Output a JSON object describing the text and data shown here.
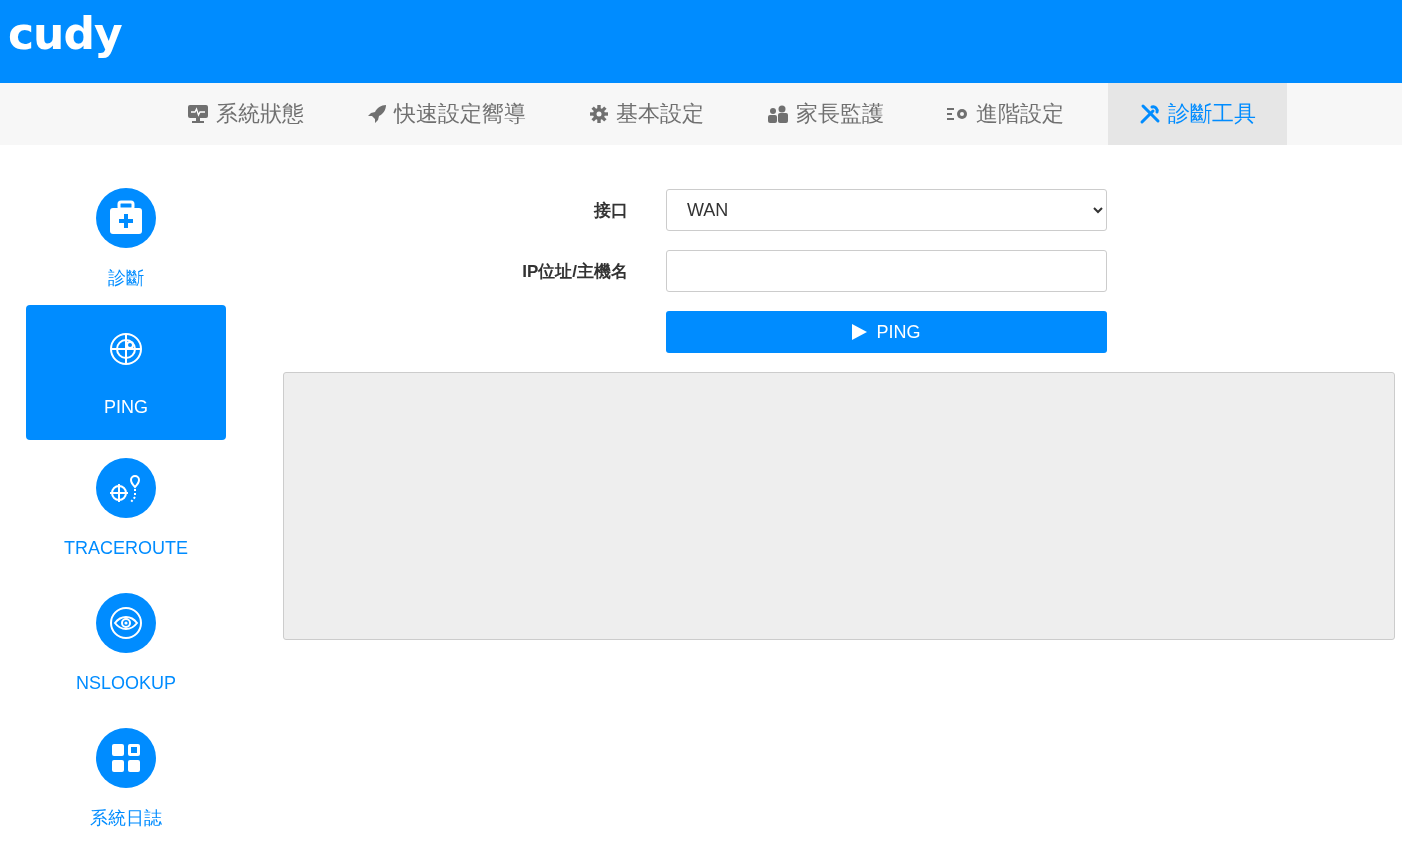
{
  "header": {
    "logo": "cudy"
  },
  "nav": [
    {
      "label": "系統狀態",
      "selected": false
    },
    {
      "label": "快速設定嚮導",
      "selected": false
    },
    {
      "label": "基本設定",
      "selected": false
    },
    {
      "label": "家長監護",
      "selected": false
    },
    {
      "label": "進階設定",
      "selected": false
    },
    {
      "label": "診斷工具",
      "selected": true
    }
  ],
  "sidebar": [
    {
      "label": "診斷",
      "selected": false
    },
    {
      "label": "PING",
      "selected": true
    },
    {
      "label": "TRACEROUTE",
      "selected": false
    },
    {
      "label": "NSLOOKUP",
      "selected": false
    },
    {
      "label": "系統日誌",
      "selected": false
    }
  ],
  "form": {
    "interface": {
      "label": "接口",
      "value": "WAN"
    },
    "host": {
      "label": "IP位址/主機名"
    },
    "button": "PING"
  }
}
